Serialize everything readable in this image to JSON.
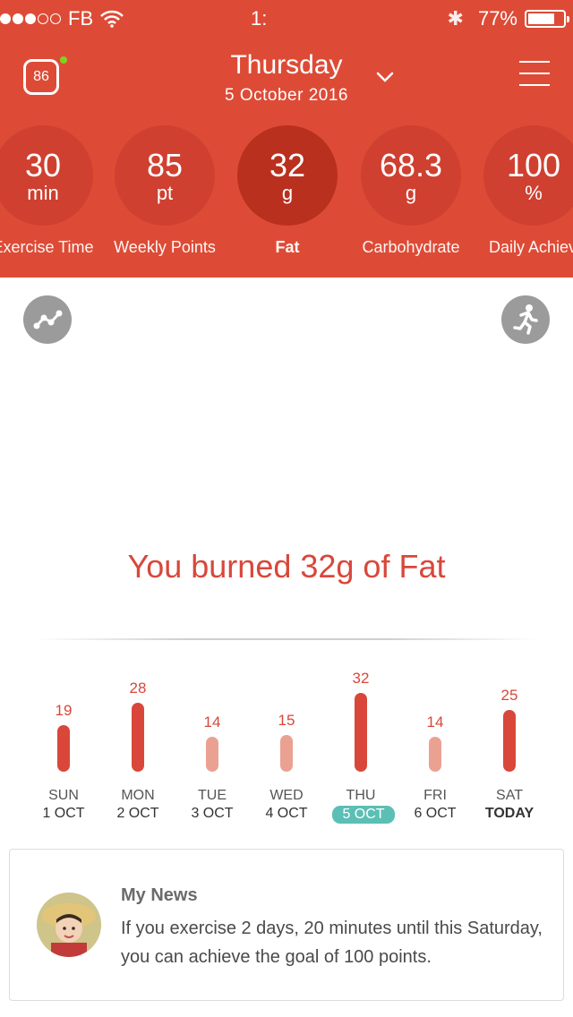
{
  "status_bar": {
    "carrier": "FB",
    "time": "1:",
    "battery": "77%",
    "battery_level": 0.77
  },
  "header": {
    "score": "86",
    "day": "Thursday",
    "date": "5 October 2016",
    "background": "#dd4b36"
  },
  "stats": [
    {
      "value": "30",
      "unit": "min",
      "label": "Exercise Time"
    },
    {
      "value": "85",
      "unit": "pt",
      "label": "Weekly Points"
    },
    {
      "value": "32",
      "unit": "g",
      "label": "Fat"
    },
    {
      "value": "68.3",
      "unit": "g",
      "label": "Carbohydrate"
    },
    {
      "value": "100",
      "unit": "%",
      "label": "Daily Achiev"
    }
  ],
  "main": {
    "headline": "You burned 32g of Fat"
  },
  "week": [
    {
      "value": 19,
      "day": "SUN",
      "date": "1 OCT"
    },
    {
      "value": 28,
      "day": "MON",
      "date": "2 OCT"
    },
    {
      "value": 14,
      "day": "TUE",
      "date": "3 OCT"
    },
    {
      "value": 15,
      "day": "WED",
      "date": "4 OCT"
    },
    {
      "value": 32,
      "day": "THU",
      "date": "5 OCT"
    },
    {
      "value": 14,
      "day": "FRI",
      "date": "6 OCT"
    },
    {
      "value": 25,
      "day": "SAT",
      "date": "TODAY"
    }
  ],
  "news": {
    "title": "My News",
    "body": "If you exercise 2 days, 20 minutes until this Saturday, you can achieve the goal of 100 points."
  },
  "colors": {
    "accent": "#d9473a",
    "bar_low": "#eba192",
    "selected_date": "#5bbfb5"
  },
  "icons": [
    "wifi-icon",
    "bluetooth-icon",
    "battery-icon",
    "chevron-down-icon",
    "menu-icon",
    "trend-icon",
    "running-icon"
  ]
}
